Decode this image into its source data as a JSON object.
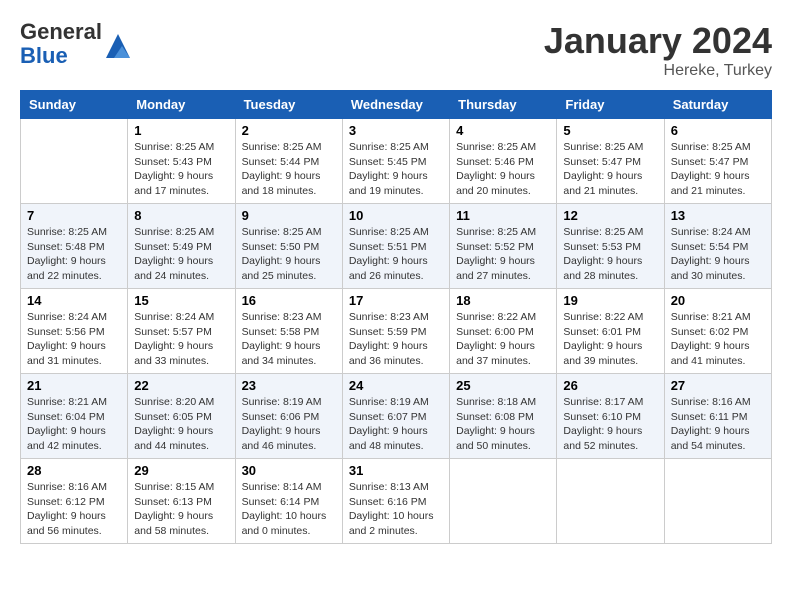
{
  "header": {
    "logo_line1": "General",
    "logo_line2": "Blue",
    "month": "January 2024",
    "location": "Hereke, Turkey"
  },
  "weekdays": [
    "Sunday",
    "Monday",
    "Tuesday",
    "Wednesday",
    "Thursday",
    "Friday",
    "Saturday"
  ],
  "weeks": [
    [
      {
        "day": "",
        "info": ""
      },
      {
        "day": "1",
        "info": "Sunrise: 8:25 AM\nSunset: 5:43 PM\nDaylight: 9 hours\nand 17 minutes."
      },
      {
        "day": "2",
        "info": "Sunrise: 8:25 AM\nSunset: 5:44 PM\nDaylight: 9 hours\nand 18 minutes."
      },
      {
        "day": "3",
        "info": "Sunrise: 8:25 AM\nSunset: 5:45 PM\nDaylight: 9 hours\nand 19 minutes."
      },
      {
        "day": "4",
        "info": "Sunrise: 8:25 AM\nSunset: 5:46 PM\nDaylight: 9 hours\nand 20 minutes."
      },
      {
        "day": "5",
        "info": "Sunrise: 8:25 AM\nSunset: 5:47 PM\nDaylight: 9 hours\nand 21 minutes."
      },
      {
        "day": "6",
        "info": "Sunrise: 8:25 AM\nSunset: 5:47 PM\nDaylight: 9 hours\nand 21 minutes."
      }
    ],
    [
      {
        "day": "7",
        "info": "Sunrise: 8:25 AM\nSunset: 5:48 PM\nDaylight: 9 hours\nand 22 minutes."
      },
      {
        "day": "8",
        "info": "Sunrise: 8:25 AM\nSunset: 5:49 PM\nDaylight: 9 hours\nand 24 minutes."
      },
      {
        "day": "9",
        "info": "Sunrise: 8:25 AM\nSunset: 5:50 PM\nDaylight: 9 hours\nand 25 minutes."
      },
      {
        "day": "10",
        "info": "Sunrise: 8:25 AM\nSunset: 5:51 PM\nDaylight: 9 hours\nand 26 minutes."
      },
      {
        "day": "11",
        "info": "Sunrise: 8:25 AM\nSunset: 5:52 PM\nDaylight: 9 hours\nand 27 minutes."
      },
      {
        "day": "12",
        "info": "Sunrise: 8:25 AM\nSunset: 5:53 PM\nDaylight: 9 hours\nand 28 minutes."
      },
      {
        "day": "13",
        "info": "Sunrise: 8:24 AM\nSunset: 5:54 PM\nDaylight: 9 hours\nand 30 minutes."
      }
    ],
    [
      {
        "day": "14",
        "info": "Sunrise: 8:24 AM\nSunset: 5:56 PM\nDaylight: 9 hours\nand 31 minutes."
      },
      {
        "day": "15",
        "info": "Sunrise: 8:24 AM\nSunset: 5:57 PM\nDaylight: 9 hours\nand 33 minutes."
      },
      {
        "day": "16",
        "info": "Sunrise: 8:23 AM\nSunset: 5:58 PM\nDaylight: 9 hours\nand 34 minutes."
      },
      {
        "day": "17",
        "info": "Sunrise: 8:23 AM\nSunset: 5:59 PM\nDaylight: 9 hours\nand 36 minutes."
      },
      {
        "day": "18",
        "info": "Sunrise: 8:22 AM\nSunset: 6:00 PM\nDaylight: 9 hours\nand 37 minutes."
      },
      {
        "day": "19",
        "info": "Sunrise: 8:22 AM\nSunset: 6:01 PM\nDaylight: 9 hours\nand 39 minutes."
      },
      {
        "day": "20",
        "info": "Sunrise: 8:21 AM\nSunset: 6:02 PM\nDaylight: 9 hours\nand 41 minutes."
      }
    ],
    [
      {
        "day": "21",
        "info": "Sunrise: 8:21 AM\nSunset: 6:04 PM\nDaylight: 9 hours\nand 42 minutes."
      },
      {
        "day": "22",
        "info": "Sunrise: 8:20 AM\nSunset: 6:05 PM\nDaylight: 9 hours\nand 44 minutes."
      },
      {
        "day": "23",
        "info": "Sunrise: 8:19 AM\nSunset: 6:06 PM\nDaylight: 9 hours\nand 46 minutes."
      },
      {
        "day": "24",
        "info": "Sunrise: 8:19 AM\nSunset: 6:07 PM\nDaylight: 9 hours\nand 48 minutes."
      },
      {
        "day": "25",
        "info": "Sunrise: 8:18 AM\nSunset: 6:08 PM\nDaylight: 9 hours\nand 50 minutes."
      },
      {
        "day": "26",
        "info": "Sunrise: 8:17 AM\nSunset: 6:10 PM\nDaylight: 9 hours\nand 52 minutes."
      },
      {
        "day": "27",
        "info": "Sunrise: 8:16 AM\nSunset: 6:11 PM\nDaylight: 9 hours\nand 54 minutes."
      }
    ],
    [
      {
        "day": "28",
        "info": "Sunrise: 8:16 AM\nSunset: 6:12 PM\nDaylight: 9 hours\nand 56 minutes."
      },
      {
        "day": "29",
        "info": "Sunrise: 8:15 AM\nSunset: 6:13 PM\nDaylight: 9 hours\nand 58 minutes."
      },
      {
        "day": "30",
        "info": "Sunrise: 8:14 AM\nSunset: 6:14 PM\nDaylight: 10 hours\nand 0 minutes."
      },
      {
        "day": "31",
        "info": "Sunrise: 8:13 AM\nSunset: 6:16 PM\nDaylight: 10 hours\nand 2 minutes."
      },
      {
        "day": "",
        "info": ""
      },
      {
        "day": "",
        "info": ""
      },
      {
        "day": "",
        "info": ""
      }
    ]
  ]
}
